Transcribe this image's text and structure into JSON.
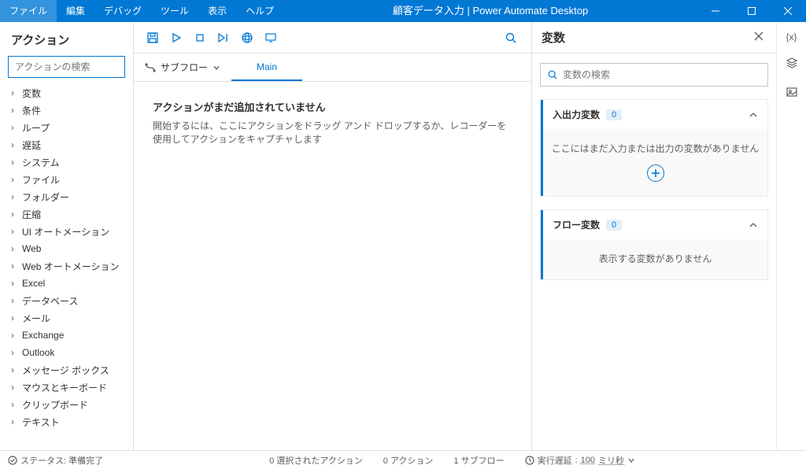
{
  "titlebar": {
    "menus": [
      "ファイル",
      "編集",
      "デバッグ",
      "ツール",
      "表示",
      "ヘルプ"
    ],
    "title": "顧客データ入力 | Power Automate Desktop"
  },
  "actions": {
    "header": "アクション",
    "search_placeholder": "アクションの検索",
    "categories": [
      "変数",
      "条件",
      "ループ",
      "遅延",
      "システム",
      "ファイル",
      "フォルダー",
      "圧縮",
      "UI オートメーション",
      "Web",
      "Web オートメーション",
      "Excel",
      "データベース",
      "メール",
      "Exchange",
      "Outlook",
      "メッセージ ボックス",
      "マウスとキーボード",
      "クリップボード",
      "テキスト"
    ]
  },
  "subflow": {
    "label": "サブフロー",
    "tab_main": "Main"
  },
  "canvas": {
    "empty_title": "アクションがまだ追加されていません",
    "empty_hint": "開始するには、ここにアクションをドラッグ アンド ドロップするか、レコーダーを使用してアクションをキャプチャします"
  },
  "variables": {
    "title": "変数",
    "search_placeholder": "変数の検索",
    "io_title": "入出力変数",
    "io_count": "0",
    "io_empty": "ここにはまだ入力または出力の変数がありません",
    "flow_title": "フロー変数",
    "flow_count": "0",
    "flow_empty": "表示する変数がありません"
  },
  "status": {
    "ready": "ステータス: 準備完了",
    "selected": "0 選択されたアクション",
    "actions": "0 アクション",
    "subflows": "1 サブフロー",
    "delay_label": "実行遅延",
    "delay_value": "100",
    "delay_unit": "ミリ秒"
  }
}
